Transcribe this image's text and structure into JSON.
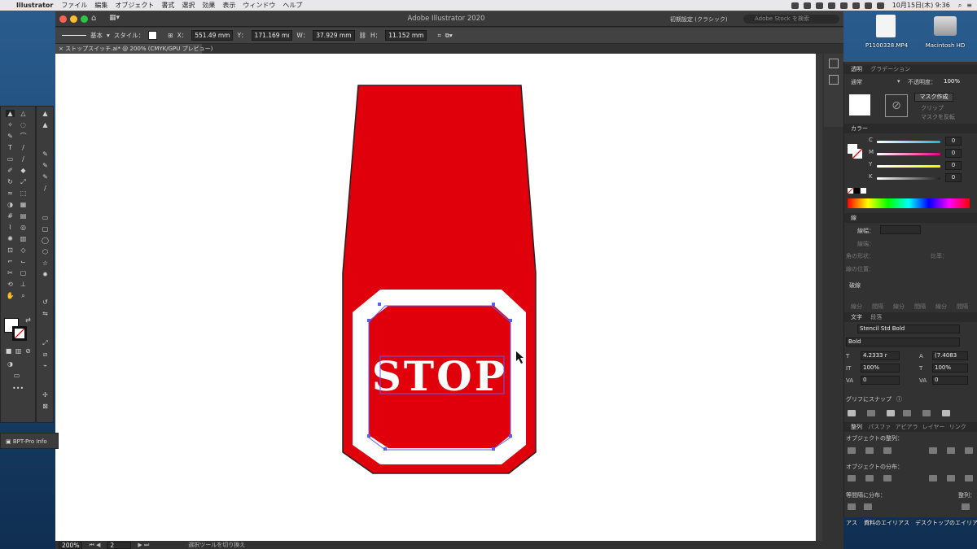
{
  "menubar": {
    "app_name": "Illustrator",
    "items": [
      "ファイル",
      "編集",
      "オブジェクト",
      "書式",
      "選択",
      "効果",
      "表示",
      "ウィンドウ",
      "ヘルプ"
    ],
    "clock": "10月15日(木)  9:36"
  },
  "window": {
    "title": "Adobe Illustrator 2020",
    "workspace": "初期設定 (クラシック)",
    "stock_search_placeholder": "Adobe Stock を検索"
  },
  "control_bar": {
    "stroke_label": "基本",
    "style_label": "スタイル：",
    "x_label": "X：",
    "x_value": "551.49 mm",
    "y_label": "Y：",
    "y_value": "171.169 mı",
    "w_label": "W：",
    "w_value": "37.929 mm",
    "h_label": "H：",
    "h_value": "11.152 mm"
  },
  "document_tab": "ストップスイッチ.ai* @ 200% (CMYK/GPU プレビュー)",
  "artwork": {
    "stop_text": "STOP",
    "fill_color": "#e0000b"
  },
  "status_bar": {
    "zoom": "200%",
    "artboard": "2",
    "tool_hint": "選択ツールを切り換え"
  },
  "bpt_panel": "BPT-Pro Info",
  "transparency_panel": {
    "tabs": [
      "透明",
      "グラデーション"
    ],
    "blend_mode": "通常",
    "opacity_label": "不透明度：",
    "opacity": "100%",
    "make_mask": "マスク作成",
    "clip": "クリップ",
    "invert_mask": "マスクを反転"
  },
  "color_panel": {
    "title": "カラー",
    "channels": [
      {
        "label": "C",
        "value": "0",
        "color": "#29abe2"
      },
      {
        "label": "M",
        "value": "0",
        "color": "#e6007e"
      },
      {
        "label": "Y",
        "value": "0",
        "color": "#fff200"
      },
      {
        "label": "K",
        "value": "0",
        "color": "#9a9a9a"
      }
    ]
  },
  "stroke_panel": {
    "title": "線",
    "weight_label": "線幅：",
    "cap_label": "線端：",
    "corner_label": "角の形状：",
    "ratio_label": "比率：",
    "align_label": "線の位置："
  },
  "dash_section": {
    "label": "破線",
    "fields": [
      "線分",
      "間隔",
      "線分",
      "間隔",
      "線分",
      "間隔"
    ]
  },
  "type_panel": {
    "tabs": [
      "文字",
      "段落"
    ],
    "font": "Stencil Std Bold",
    "style": "Bold",
    "size": "4.2333 r",
    "leading": "(7.4083",
    "vscale": "100%",
    "hscale": "100%",
    "kerning": "0",
    "tracking": "0"
  },
  "glyph_snap": {
    "label": "グリフにスナップ"
  },
  "align_panel": {
    "tabs": [
      "整列",
      "パスファ",
      "アピアラ",
      "レイヤー",
      "リンク"
    ],
    "align_objects": "オブジェクトの整列：",
    "distribute_objects": "オブジェクトの分布：",
    "distribute_spacing": "等間隔に分布：",
    "align_to": "整列："
  },
  "desktop": {
    "file_label": "P1100328.MP4",
    "hd_label": "Macintosh HD",
    "alias1": "資料のエイリアス",
    "alias2": "デスクトップのエイリアス",
    "alias3": "アス"
  }
}
